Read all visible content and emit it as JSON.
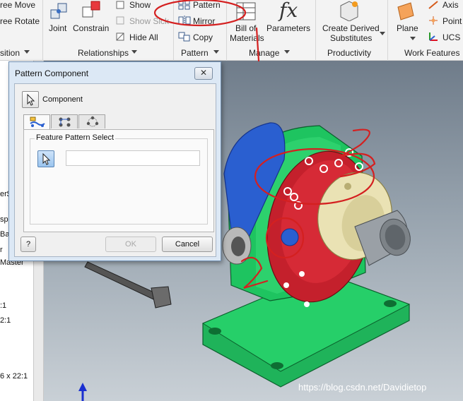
{
  "ribbon": {
    "items": {
      "free_move": "ree Move",
      "free_rotate": "ree Rotate",
      "joint": "Joint",
      "constrain": "Constrain",
      "show": "Show",
      "show_sick": "Show Sick",
      "hide_all": "Hide All",
      "pattern": "Pattern",
      "mirror": "Mirror",
      "copy": "Copy",
      "bill_of_materials_1": "Bill of",
      "bill_of_materials_2": "Materials",
      "parameters": "Parameters",
      "create_derived_1": "Create Derived",
      "create_derived_2": "Substitutes",
      "plane": "Plane",
      "axis": "Axis",
      "point": "Point",
      "ucs": "UCS"
    },
    "groups": {
      "position": "sition",
      "relationships": "Relationships",
      "pattern": "Pattern",
      "manage": "Manage",
      "productivity": "Productivity",
      "work_features": "Work Features"
    },
    "icons": [
      "joint-icon",
      "constrain-icon",
      "pattern-icon",
      "mirror-icon",
      "copy-icon",
      "bom-icon",
      "fx-icon",
      "derived-icon",
      "plane-icon",
      "axis-icon",
      "point-icon",
      "ucs-icon"
    ]
  },
  "browser": {
    "items": [
      "er$",
      "sp",
      "Ba",
      "r",
      "Master",
      ":1",
      "2:1",
      "6 x 22:1"
    ]
  },
  "dialog": {
    "title": "Pattern Component",
    "close_label": "✕",
    "component_label": "Component",
    "tab_icons": [
      "associative-pattern-icon",
      "rectangular-pattern-icon",
      "circular-pattern-icon"
    ],
    "fieldset_label": "Feature Pattern Select",
    "input_value": "",
    "ok_label": "OK",
    "cancel_label": "Cancel",
    "help_label": "?"
  },
  "annotations": {
    "marks": [
      "1",
      "2",
      "3",
      "3",
      "2"
    ]
  },
  "watermark": "https://blog.csdn.net/Davidietop",
  "colors": {
    "accent_red": "#d42020",
    "part_green": "#19c25e",
    "part_red": "#c4202c",
    "part_blue": "#2a5fd0",
    "part_cream": "#eae2b4",
    "dialog_frame": "#dce8f5"
  }
}
